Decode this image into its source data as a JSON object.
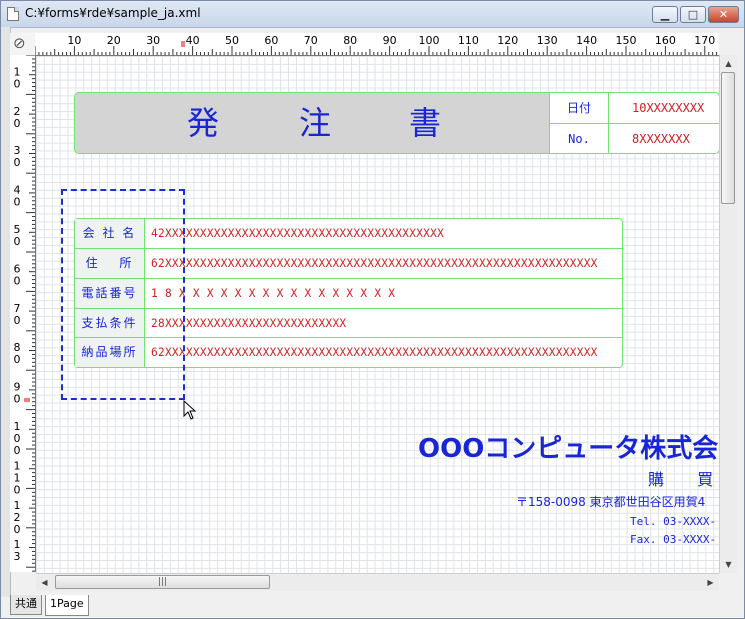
{
  "window": {
    "title": "C:¥forms¥rde¥sample_ja.xml",
    "min_label": "▁",
    "max_label": "□",
    "close_label": "✕"
  },
  "ruler": {
    "h_labels": [
      "10",
      "20",
      "30",
      "40",
      "50",
      "60",
      "70",
      "80",
      "90",
      "100",
      "110",
      "120",
      "130",
      "140",
      "150",
      "160",
      "170"
    ],
    "v_labels": [
      [
        "1",
        "0"
      ],
      [
        "2",
        "0"
      ],
      [
        "3",
        "0"
      ],
      [
        "4",
        "0"
      ],
      [
        "5",
        "0"
      ],
      [
        "6",
        "0"
      ],
      [
        "7",
        "0"
      ],
      [
        "8",
        "0"
      ],
      [
        "9",
        "0"
      ],
      [
        "1",
        "0",
        "0"
      ],
      [
        "1",
        "1",
        "0"
      ],
      [
        "1",
        "2",
        "0"
      ],
      [
        "1",
        "3"
      ]
    ]
  },
  "form": {
    "title_chars": [
      "発",
      "注",
      "書"
    ],
    "date_label": "日付",
    "date_value": "10XXXXXXXX",
    "no_label": "No.",
    "no_value": "8XXXXXXX",
    "rows": [
      {
        "label": "会 社 名",
        "value": "42XXXXXXXXXXXXXXXXXXXXXXXXXXXXXXXXXXXXXXXX"
      },
      {
        "label": "住　 所",
        "value": "62XXXXXXXXXXXXXXXXXXXXXXXXXXXXXXXXXXXXXXXXXXXXXXXXXXXXXXXXXXXXXX"
      },
      {
        "label": "電話番号",
        "value": "1 8 X X X X X X X X X X X X X X X X"
      },
      {
        "label": "支払条件",
        "value": "28XXXXXXXXXXXXXXXXXXXXXXXXXX"
      },
      {
        "label": "納品場所",
        "value": "62XXXXXXXXXXXXXXXXXXXXXXXXXXXXXXXXXXXXXXXXXXXXXXXXXXXXXXXXXXXXXX"
      }
    ],
    "company": "OOOコンピュータ株式会",
    "dept": "購 買",
    "address": "〒158-0098 東京都世田谷区用賀4",
    "tel": "Tel. 03-XXXX-",
    "fax": "Fax. 03-XXXX-"
  },
  "scroll": {
    "h_thumb_grip": "|||"
  },
  "tabs": [
    "共通",
    "1Page"
  ]
}
